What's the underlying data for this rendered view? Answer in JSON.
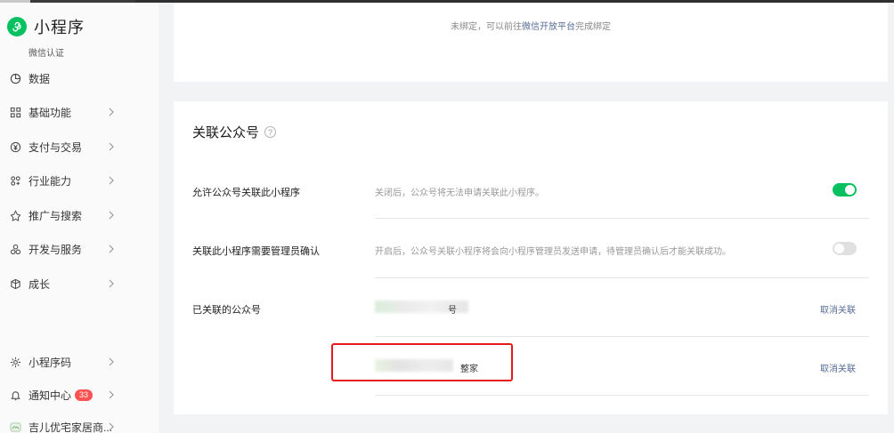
{
  "brand": {
    "title": "小程序",
    "verification": "微信认证"
  },
  "sidebar": {
    "items": [
      {
        "label": "数据",
        "icon": "pie-chart-icon",
        "chevron": false
      },
      {
        "label": "基础功能",
        "icon": "grid-icon",
        "chevron": true
      },
      {
        "label": "支付与交易",
        "icon": "yen-circle-icon",
        "chevron": true
      },
      {
        "label": "行业能力",
        "icon": "industry-icon",
        "chevron": true
      },
      {
        "label": "推广与搜索",
        "icon": "promote-icon",
        "chevron": true
      },
      {
        "label": "开发与服务",
        "icon": "develop-icon",
        "chevron": true
      },
      {
        "label": "成长",
        "icon": "growth-icon",
        "chevron": true
      }
    ],
    "bottom_items": [
      {
        "label": "小程序码",
        "icon": "mini-code-icon",
        "chevron": true
      },
      {
        "label": "通知中心",
        "icon": "bell-icon",
        "badge": "33",
        "chevron": true
      },
      {
        "label": "吉儿优宅家居商...",
        "icon": "account-avatar-icon",
        "chevron": true
      }
    ]
  },
  "top_card": {
    "text_before": "未绑定，可以前往",
    "link": "微信开放平台",
    "text_after": "完成绑定"
  },
  "section": {
    "title": "关联公众号",
    "rows": [
      {
        "label": "允许公众号关联此小程序",
        "desc": "关闭后，公众号将无法申请关联此小程序。",
        "toggle": "on"
      },
      {
        "label": "关联此小程序需要管理员确认",
        "desc": "开启后，公众号关联小程序将会向小程序管理员发送申请，待管理员确认后才能关联成功。",
        "toggle": "off"
      }
    ],
    "linked_label": "已关联的公众号",
    "linked_accounts": [
      {
        "name": "号",
        "action": "取消关联"
      },
      {
        "name": "整家",
        "action": "取消关联"
      }
    ]
  },
  "colors": {
    "accent": "#07c160",
    "link": "#576b95",
    "badge": "#fa5151",
    "highlight": "#e61919"
  }
}
